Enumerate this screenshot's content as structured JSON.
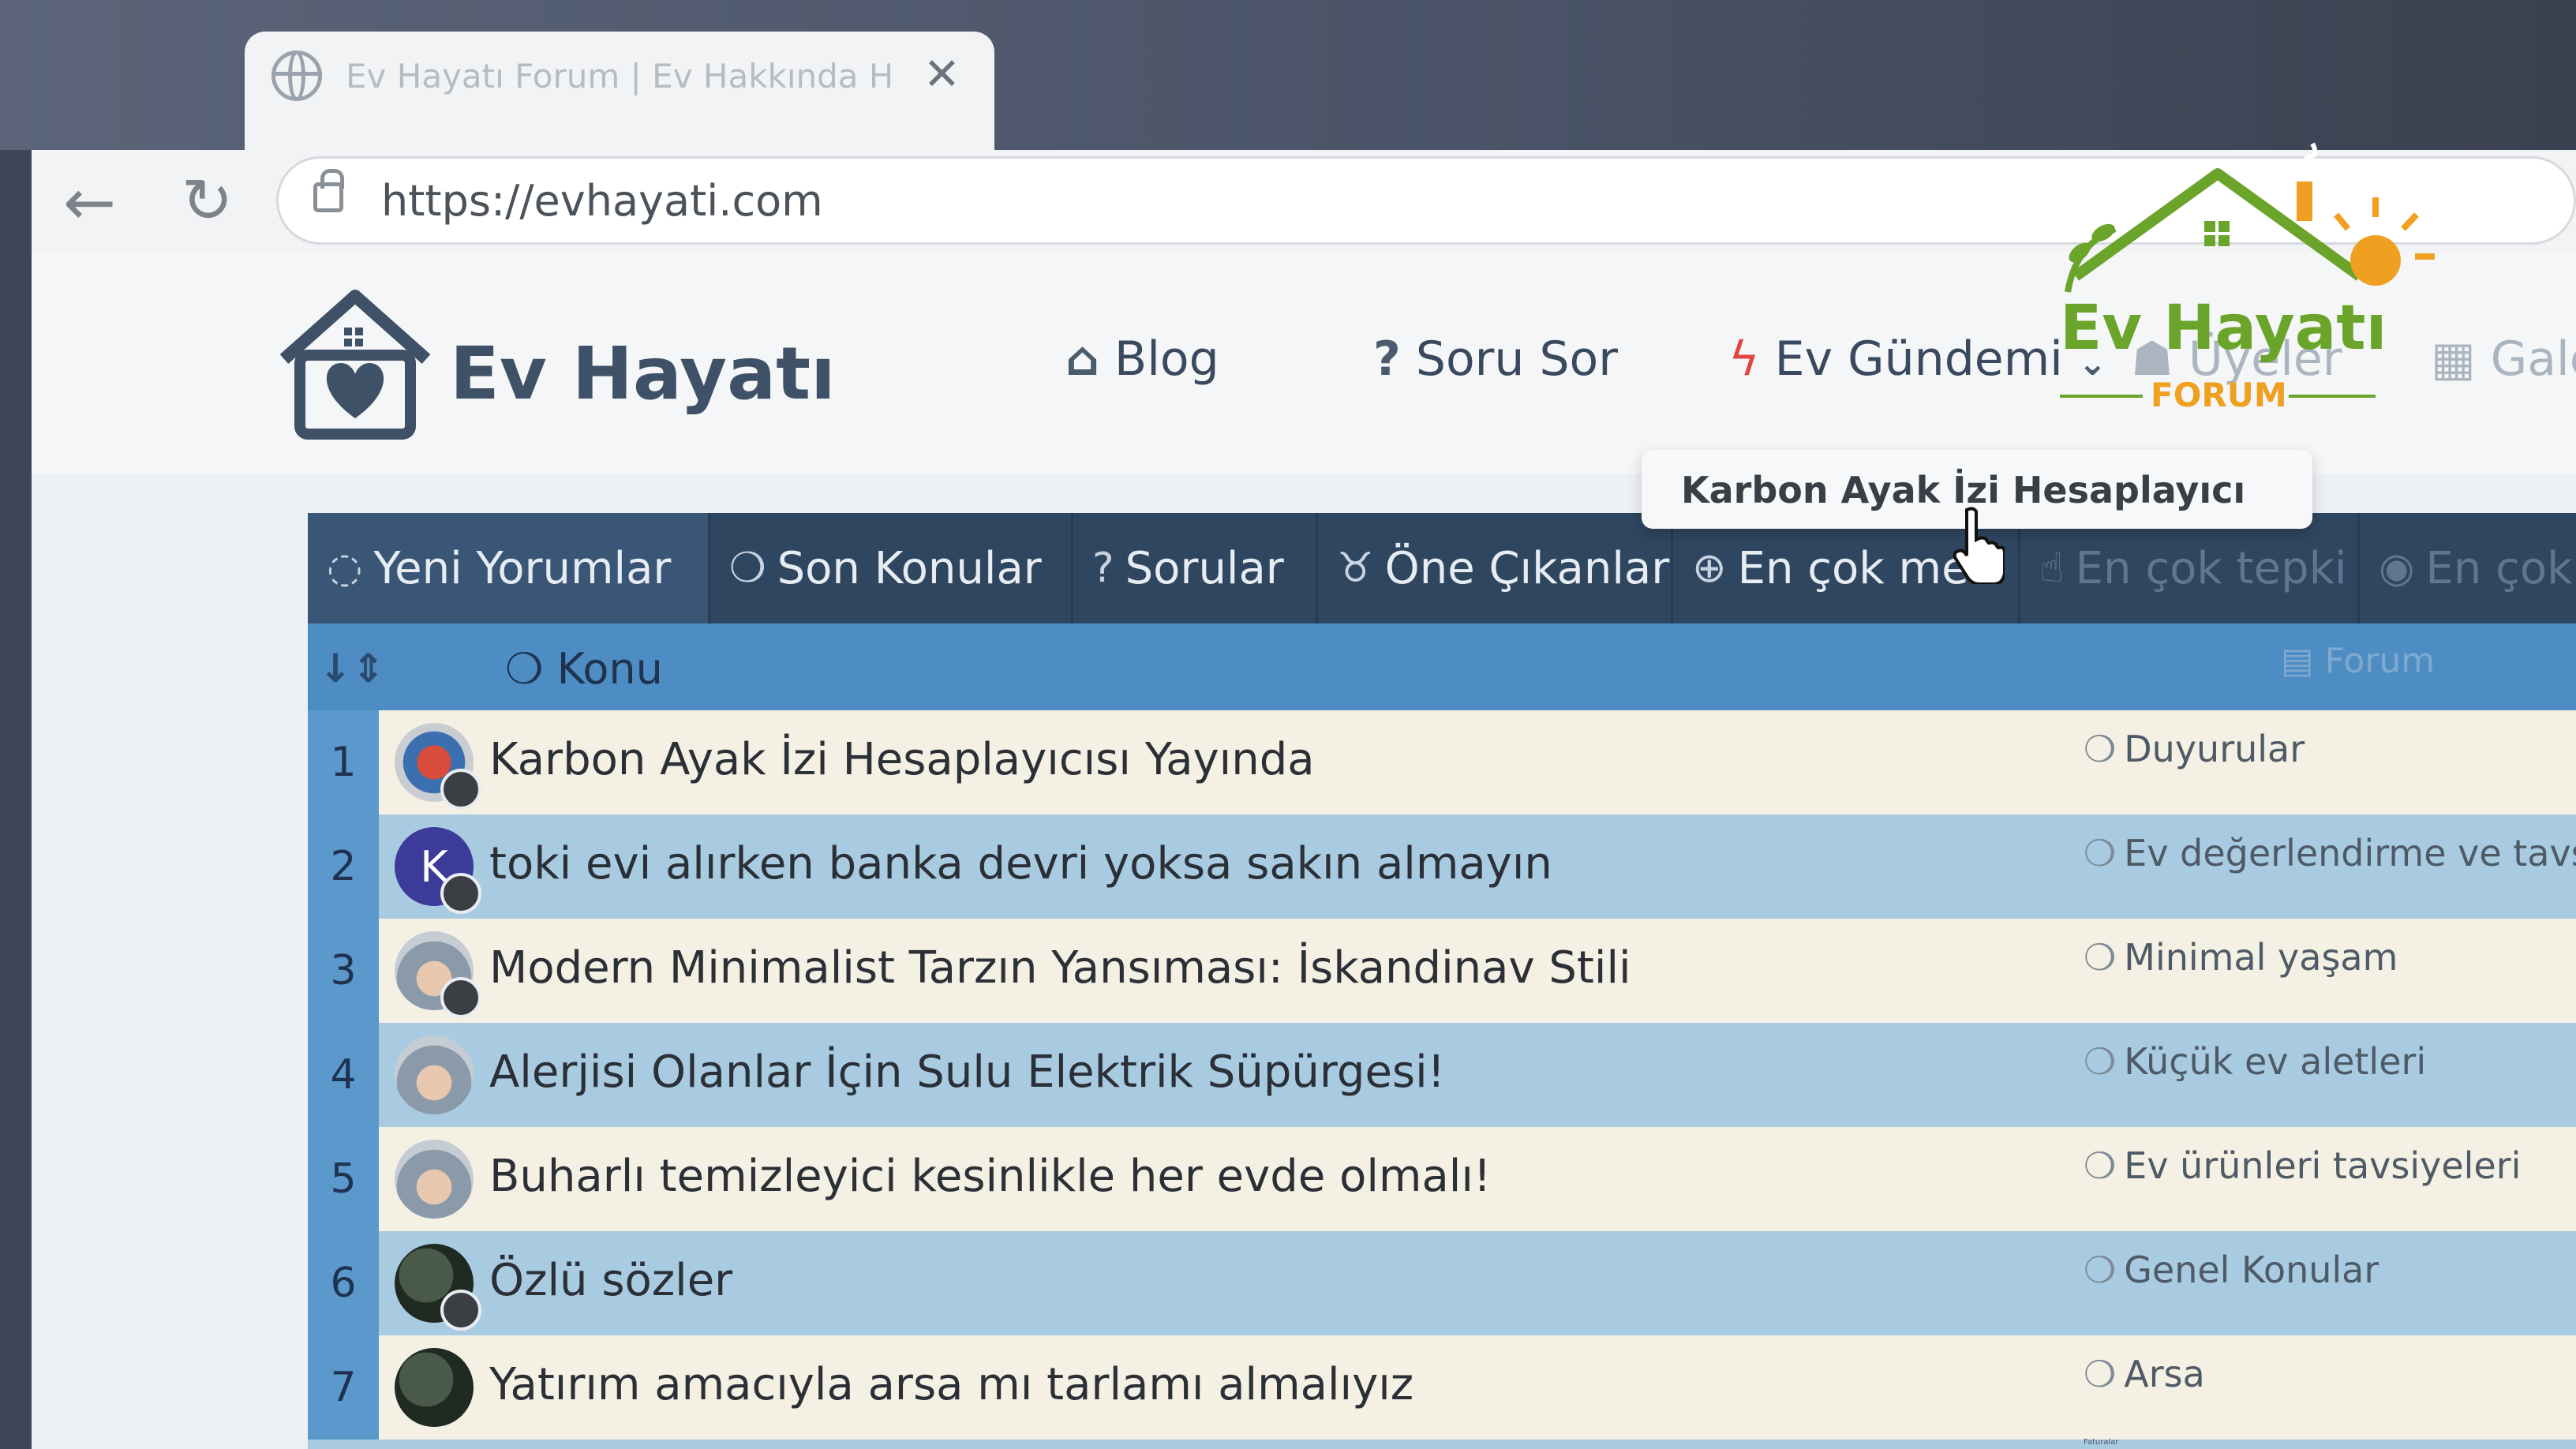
{
  "browser": {
    "tab_title": "Ev Hayatı Forum | Ev Hakkında Her",
    "url": "https://evhayati.com"
  },
  "site": {
    "logo_text": "Ev Hayatı",
    "nav": [
      {
        "label": "Blog",
        "icon": "home-icon"
      },
      {
        "label": "Soru Sor",
        "icon": "question-icon"
      },
      {
        "label": "Ev Gündemi",
        "icon": "bolt-icon"
      },
      {
        "label": "Üyeler",
        "icon": "users-icon"
      },
      {
        "label": "Galer",
        "icon": "gallery-icon"
      }
    ],
    "dropdown_item": "Karbon Ayak İzi Hesaplayıcı",
    "brand_logo": {
      "title": "Ev Hayatı",
      "subtitle": "FORUM"
    }
  },
  "forum_tabs": [
    {
      "label": "Yeni Yorumlar",
      "icon": "comment-icon"
    },
    {
      "label": "Son Konular",
      "icon": "comments-icon"
    },
    {
      "label": "Sorular",
      "icon": "question-icon"
    },
    {
      "label": "Öne Çıkanlar",
      "icon": "medal-icon"
    },
    {
      "label": "En çok mes",
      "icon": "message-plus-icon"
    },
    {
      "label": "En çok tepki",
      "icon": "thumbs-up-icon"
    },
    {
      "label": "En çok gö",
      "icon": "eye-icon"
    }
  ],
  "table": {
    "header_konu": "Konu",
    "header_forum": "Forum",
    "rows": [
      {
        "num": "1",
        "title": "Karbon Ayak İzi Hesaplayıcısı Yayında",
        "category": "Duyurular"
      },
      {
        "num": "2",
        "title": "toki evi alırken banka devri yoksa sakın almayın",
        "category": "Ev değerlendirme ve tavsiye"
      },
      {
        "num": "3",
        "title": "Modern Minimalist Tarzın Yansıması: İskandinav Stili",
        "category": "Minimal yaşam"
      },
      {
        "num": "4",
        "title": "Alerjisi Olanlar İçin Sulu Elektrik Süpürgesi!",
        "category": "Küçük ev aletleri"
      },
      {
        "num": "5",
        "title": "Buharlı temizleyici kesinlikle her evde olmalı!",
        "category": "Ev ürünleri tavsiyeleri"
      },
      {
        "num": "6",
        "title": "Özlü sözler",
        "category": "Genel Konular"
      },
      {
        "num": "7",
        "title": "Yatırım amacıyla arsa mı tarlamı almalıyız",
        "category": "Arsa"
      },
      {
        "num": "",
        "title": "",
        "category": "Faturalar"
      }
    ]
  },
  "colors": {
    "tab_bar": "#2f4660",
    "active_tab": "#3a5677",
    "table_header": "#4e8dc4",
    "row_number": "#5b98cc",
    "row_odd": "#f4f0e3",
    "row_even": "#a9cbe2",
    "brand_green": "#7ab52e",
    "brand_orange": "#f0a020"
  }
}
